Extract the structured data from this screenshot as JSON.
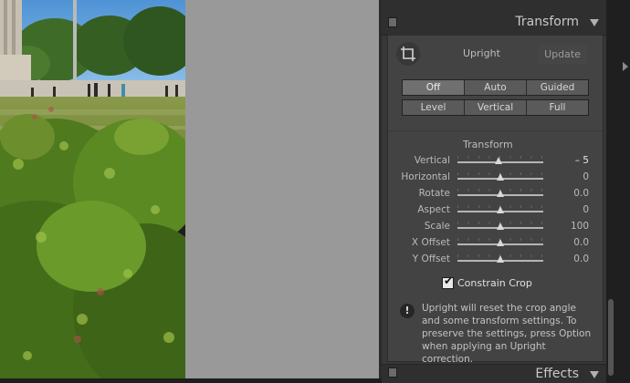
{
  "panel": {
    "header_title": "Transform",
    "bottom_header_title": "Effects",
    "upright_label": "Upright",
    "update_label": "Update",
    "upright_modes_row1": [
      "Off",
      "Auto",
      "Guided"
    ],
    "upright_modes_row2": [
      "Level",
      "Vertical",
      "Full"
    ],
    "selected_mode": "Off",
    "transform_subtitle": "Transform",
    "sliders": [
      {
        "label": "Vertical",
        "value": "– 5",
        "level": -5
      },
      {
        "label": "Horizontal",
        "value": "0",
        "level": 0
      },
      {
        "label": "Rotate",
        "value": "0.0",
        "level": 0
      },
      {
        "label": "Aspect",
        "value": "0",
        "level": 0
      },
      {
        "label": "Scale",
        "value": "100",
        "level": 0
      },
      {
        "label": "X Offset",
        "value": "0.0",
        "level": 0
      },
      {
        "label": "Y Offset",
        "value": "0.0",
        "level": 0
      }
    ],
    "constrain_crop_label": "Constrain Crop",
    "constrain_crop_checked": true,
    "info_text": "Upright will reset the crop angle and some transform settings. To preserve the settings, press Option when applying an Upright correction."
  },
  "colors": {
    "panel_bg": "#373737",
    "section_bg": "#434343",
    "canvas_gray": "#999999"
  },
  "icons": {
    "crop": "crop-icon",
    "info": "info-icon",
    "collapse": "triangle-down-icon",
    "expand_right": "triangle-right-icon"
  }
}
